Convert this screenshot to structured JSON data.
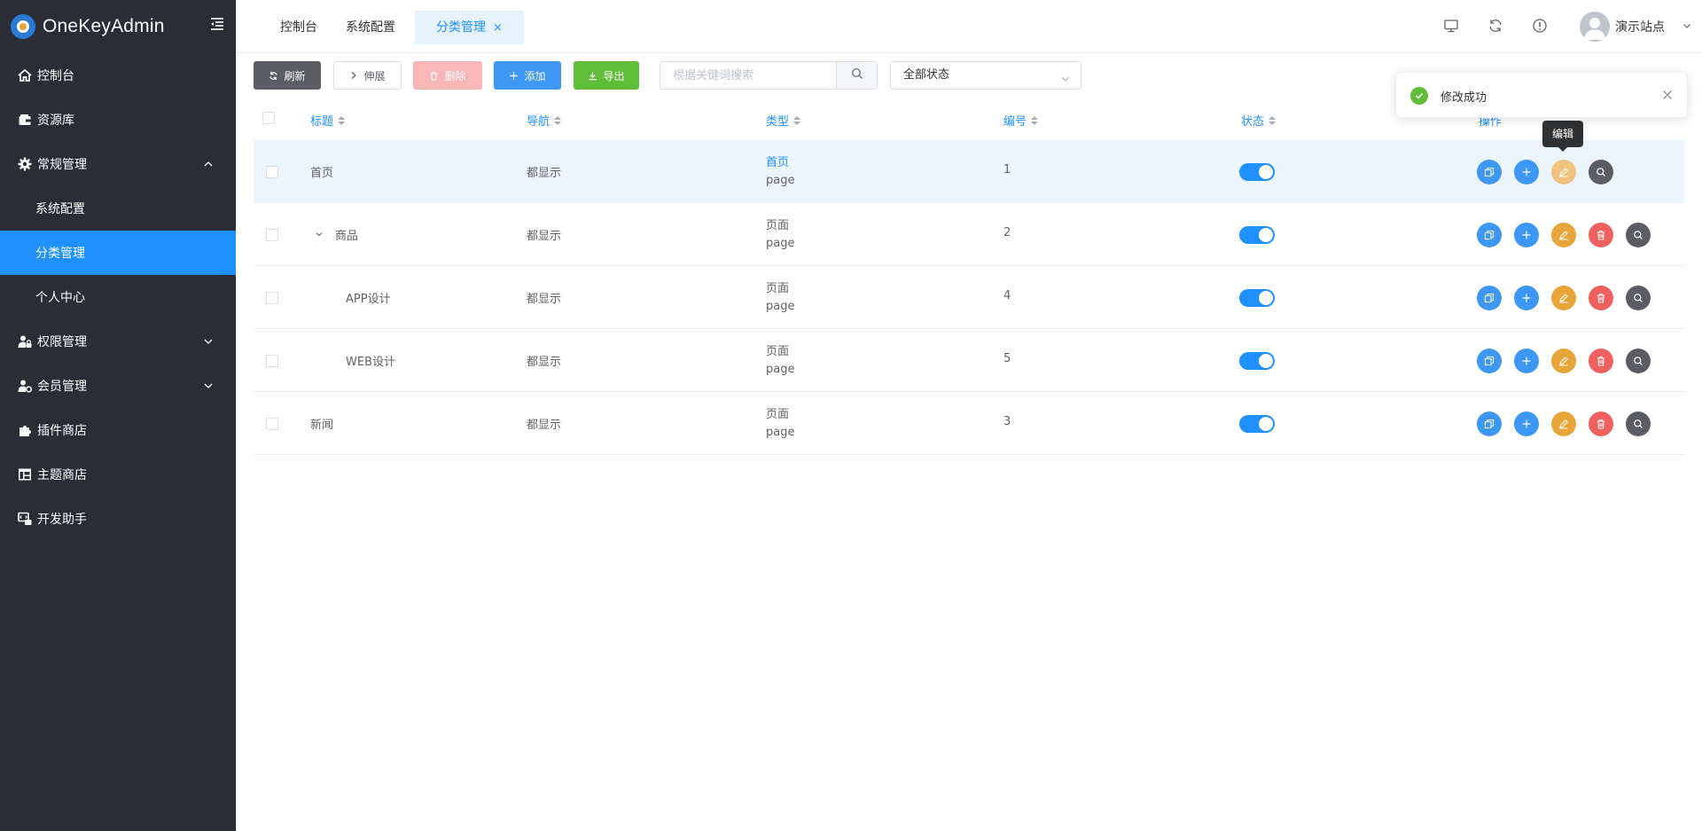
{
  "app": {
    "title": "OneKeyAdmin"
  },
  "sidebar": {
    "items": [
      {
        "label": "控制台",
        "icon": "home-icon"
      },
      {
        "label": "资源库",
        "icon": "wallet-icon"
      },
      {
        "label": "常规管理",
        "icon": "gear-icon",
        "expanded": true,
        "children": [
          {
            "label": "系统配置"
          },
          {
            "label": "分类管理",
            "active": true
          },
          {
            "label": "个人中心"
          }
        ]
      },
      {
        "label": "权限管理",
        "icon": "user-lock-icon",
        "expanded": false
      },
      {
        "label": "会员管理",
        "icon": "user-gear-icon",
        "expanded": false
      },
      {
        "label": "插件商店",
        "icon": "puzzle-icon"
      },
      {
        "label": "主题商店",
        "icon": "layout-icon"
      },
      {
        "label": "开发助手",
        "icon": "code-icon"
      }
    ]
  },
  "tabs": [
    {
      "label": "控制台"
    },
    {
      "label": "系统配置"
    },
    {
      "label": "分类管理",
      "active": true,
      "close": "×"
    }
  ],
  "header": {
    "user_name": "演示站点"
  },
  "toolbar": {
    "refresh": "刷新",
    "expand": "伸展",
    "delete": "删除",
    "add": "添加",
    "export": "导出",
    "search_placeholder": "根据关键词搜索",
    "status_select": "全部状态"
  },
  "table": {
    "columns": [
      "标题",
      "导航",
      "类型",
      "编号",
      "状态",
      "操作"
    ],
    "rows": [
      {
        "title": "首页",
        "nav": "都显示",
        "type_label": "首页",
        "type_value": "page",
        "number": "1",
        "status": true,
        "indent": 0
      },
      {
        "title": "商品",
        "nav": "都显示",
        "type_label": "页面",
        "type_value": "page",
        "number": "2",
        "status": true,
        "indent": 1,
        "expandable": true
      },
      {
        "title": "APP设计",
        "nav": "都显示",
        "type_label": "页面",
        "type_value": "page",
        "number": "4",
        "status": true,
        "indent": 2
      },
      {
        "title": "WEB设计",
        "nav": "都显示",
        "type_label": "页面",
        "type_value": "page",
        "number": "5",
        "status": true,
        "indent": 2
      },
      {
        "title": "新闻",
        "nav": "都显示",
        "type_label": "页面",
        "type_value": "page",
        "number": "3",
        "status": true,
        "indent": 0
      }
    ]
  },
  "tooltip": {
    "text": "编辑"
  },
  "notification": {
    "text": "修改成功",
    "type": "success"
  },
  "colors": {
    "primary": "#1e90ff",
    "sidebar_bg": "#2a2d35",
    "success": "#5fbd3a",
    "warning": "#e8a53a",
    "danger": "#f0605f"
  }
}
